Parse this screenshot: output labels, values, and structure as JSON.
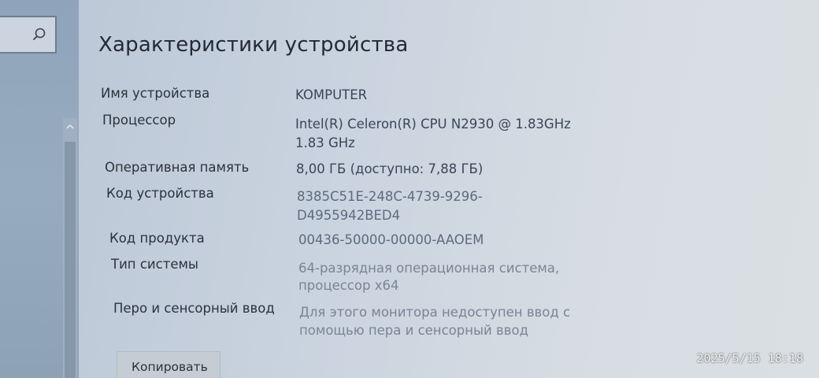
{
  "page": {
    "title": "Характеристики устройства"
  },
  "device_specs": [
    {
      "label": "Имя устройства",
      "value": [
        "KOMPUTER"
      ]
    },
    {
      "label": "Процессор",
      "value": [
        "Intel(R) Celeron(R) CPU  N2930  @ 1.83GHz",
        "1.83 GHz"
      ]
    },
    {
      "label": "Оперативная память",
      "value": [
        "8,00 ГБ (доступно: 7,88 ГБ)"
      ]
    },
    {
      "label": "Код устройства",
      "value": [
        "8385C51E-248C-4739-9296-",
        "D4955942BED4"
      ]
    },
    {
      "label": "Код продукта",
      "value": [
        "00436-50000-00000-AAOEM"
      ]
    },
    {
      "label": "Тип системы",
      "value": [
        "64-разрядная операционная система,",
        "процессор x64"
      ]
    },
    {
      "label": "Перо и сенсорный ввод",
      "value": [
        "Для этого монитора недоступен ввод с",
        "помощью пера и сенсорный ввод"
      ]
    }
  ],
  "actions": {
    "copy_label": "Копировать"
  },
  "overlay": {
    "timestamp": "2025/5/15 18:18"
  },
  "icons": {
    "search": "search-icon",
    "scroll_up": "chevron-up-icon"
  }
}
